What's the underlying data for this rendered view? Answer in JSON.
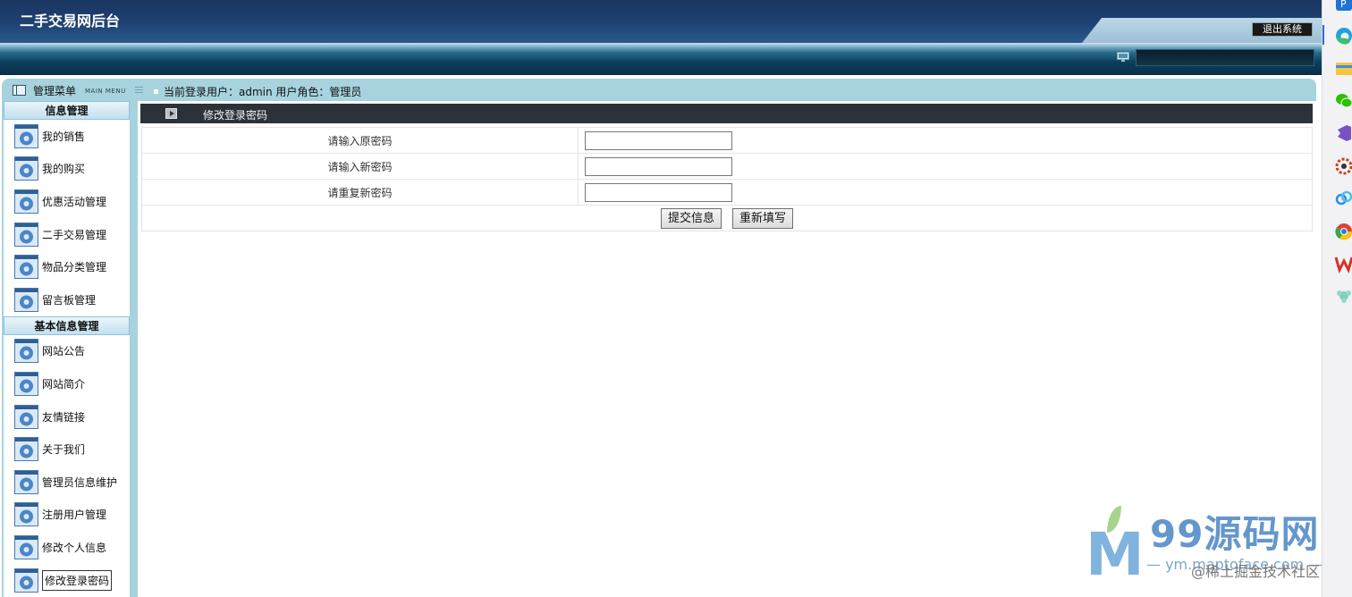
{
  "header": {
    "title": "二手交易网后台",
    "logout_label": "退出系统"
  },
  "menu": {
    "title": "管理菜单",
    "subtitle": "MAIN MENU"
  },
  "user_bar": {
    "text": "当前登录用户：admin  用户角色：管理员"
  },
  "sidebar": {
    "sections": [
      {
        "title": "信息管理",
        "items": [
          "我的销售",
          "我的购买",
          "优惠活动管理",
          "二手交易管理",
          "物品分类管理",
          "留言板管理"
        ]
      },
      {
        "title": "基本信息管理",
        "items": [
          "网站公告",
          "网站简介",
          "友情链接",
          "关于我们",
          "管理员信息维护",
          "注册用户管理",
          "修改个人信息",
          "修改登录密码"
        ]
      }
    ],
    "active_item": "修改登录密码"
  },
  "panel": {
    "title": "修改登录密码"
  },
  "form": {
    "fields": [
      {
        "label": "请输入原密码",
        "value": ""
      },
      {
        "label": "请输入新密码",
        "value": ""
      },
      {
        "label": "请重复新密码",
        "value": ""
      }
    ],
    "submit_label": "提交信息",
    "reset_label": "重新填写"
  },
  "taskbar": {
    "icons": [
      "p-app-icon",
      "edge-icon",
      "file-explorer-icon",
      "wechat-icon",
      "visual-studio-icon",
      "settings-gear-icon",
      "baidu-netdisk-icon",
      "chrome-icon",
      "wps-icon",
      "snipaste-icon"
    ]
  },
  "watermark": {
    "brand": "99源码网",
    "url": "— ym.maptoface.com —",
    "community": "@稀土掘金技术社区"
  },
  "colors": {
    "header_dark": "#1e4272",
    "frame_blue": "#a6d3de",
    "panel_header": "#2c3338",
    "taskbar_accent": "#2f6bd2"
  }
}
